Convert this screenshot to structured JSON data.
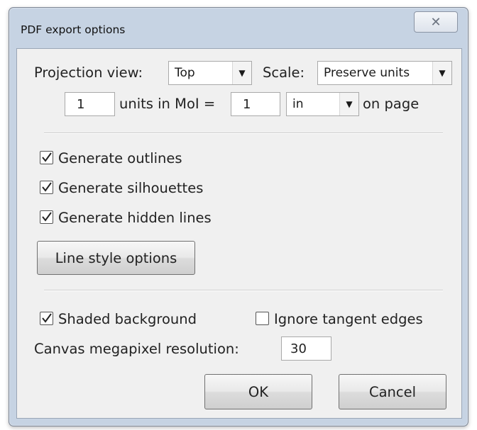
{
  "window": {
    "title": "PDF export options",
    "close_glyph": "✕"
  },
  "projection": {
    "label": "Projection view:",
    "selected": "Top",
    "scale_label": "Scale:",
    "scale_selected": "Preserve units"
  },
  "units": {
    "model_value": "1",
    "middle_label": "units in MoI =",
    "page_value": "1",
    "unit_selected": "in",
    "suffix_label": "on page"
  },
  "options": {
    "generate_outlines": {
      "label": "Generate outlines",
      "checked": true
    },
    "generate_silhouettes": {
      "label": "Generate silhouettes",
      "checked": true
    },
    "generate_hidden_lines": {
      "label": "Generate hidden lines",
      "checked": true
    },
    "line_style_button": "Line style options"
  },
  "render": {
    "shaded_background": {
      "label": "Shaded background",
      "checked": true
    },
    "ignore_tangent_edges": {
      "label": "Ignore tangent edges",
      "checked": false
    },
    "resolution_label": "Canvas megapixel resolution:",
    "resolution_value": "30"
  },
  "buttons": {
    "ok": "OK",
    "cancel": "Cancel"
  }
}
